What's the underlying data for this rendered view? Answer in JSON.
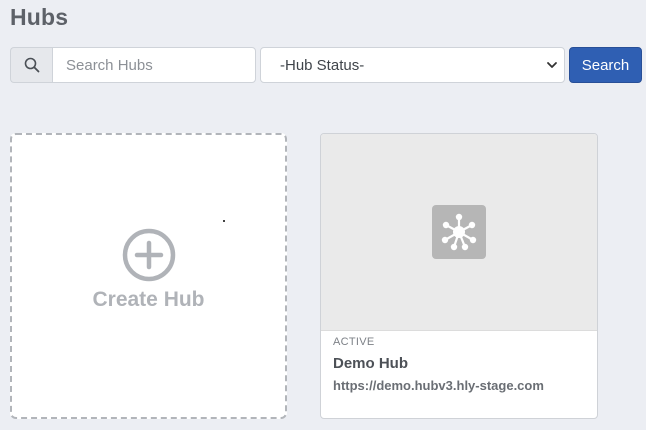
{
  "header": {
    "title": "Hubs"
  },
  "search": {
    "icon": "search-icon",
    "placeholder": "Search Hubs",
    "value": "",
    "status_filter": {
      "selected": "-Hub Status-",
      "icon": "chevron-down-icon"
    },
    "button_label": "Search",
    "button_color": "#2f5fb3"
  },
  "create_card": {
    "icon": "plus-circle-icon",
    "label": "Create Hub"
  },
  "hubs": [
    {
      "logo_icon": "network-hub-icon",
      "status": "ACTIVE",
      "name": "Demo Hub",
      "url": "https://demo.hubv3.hly-stage.com"
    }
  ]
}
